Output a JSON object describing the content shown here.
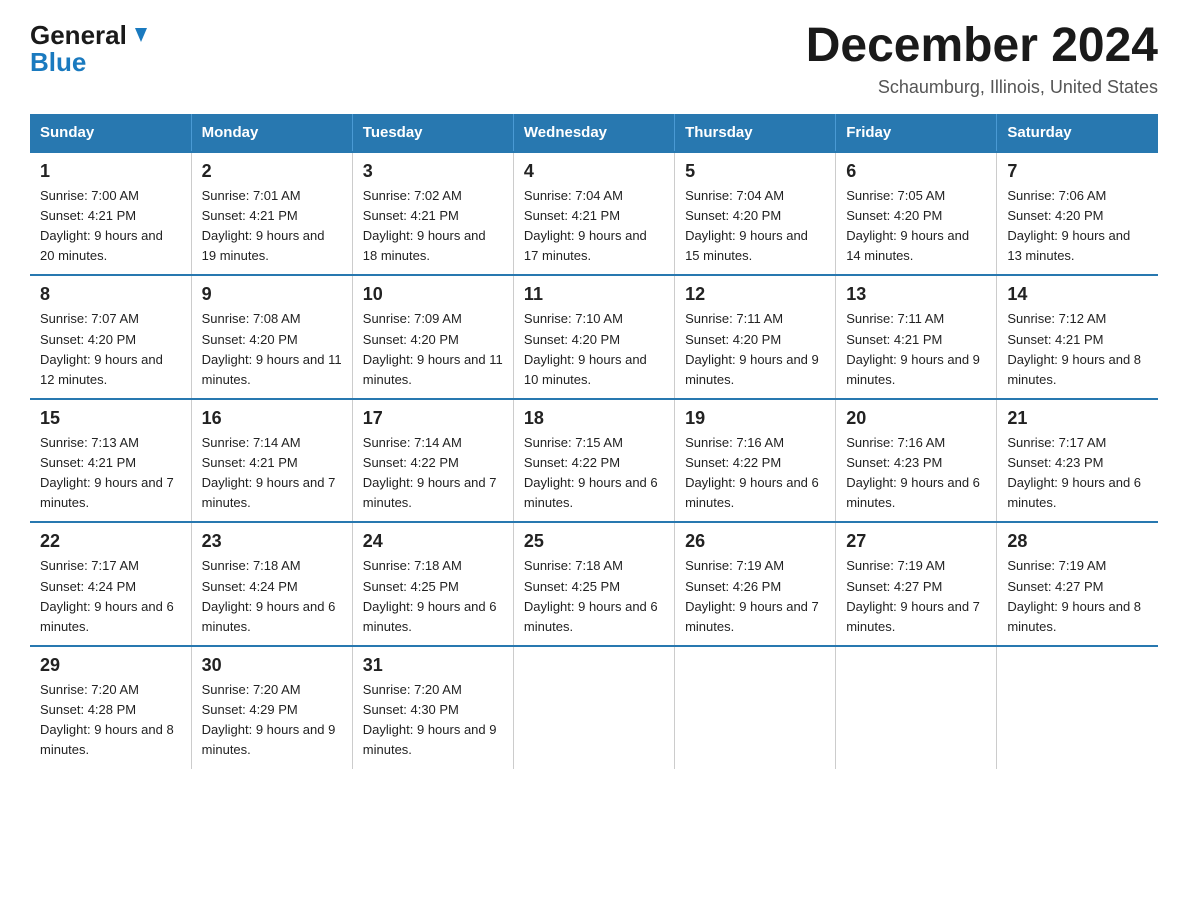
{
  "header": {
    "logo_general": "General",
    "logo_blue": "Blue",
    "title": "December 2024",
    "location": "Schaumburg, Illinois, United States"
  },
  "days_of_week": [
    "Sunday",
    "Monday",
    "Tuesday",
    "Wednesday",
    "Thursday",
    "Friday",
    "Saturday"
  ],
  "weeks": [
    [
      {
        "day": "1",
        "sunrise": "7:00 AM",
        "sunset": "4:21 PM",
        "daylight": "9 hours and 20 minutes."
      },
      {
        "day": "2",
        "sunrise": "7:01 AM",
        "sunset": "4:21 PM",
        "daylight": "9 hours and 19 minutes."
      },
      {
        "day": "3",
        "sunrise": "7:02 AM",
        "sunset": "4:21 PM",
        "daylight": "9 hours and 18 minutes."
      },
      {
        "day": "4",
        "sunrise": "7:04 AM",
        "sunset": "4:21 PM",
        "daylight": "9 hours and 17 minutes."
      },
      {
        "day": "5",
        "sunrise": "7:04 AM",
        "sunset": "4:20 PM",
        "daylight": "9 hours and 15 minutes."
      },
      {
        "day": "6",
        "sunrise": "7:05 AM",
        "sunset": "4:20 PM",
        "daylight": "9 hours and 14 minutes."
      },
      {
        "day": "7",
        "sunrise": "7:06 AM",
        "sunset": "4:20 PM",
        "daylight": "9 hours and 13 minutes."
      }
    ],
    [
      {
        "day": "8",
        "sunrise": "7:07 AM",
        "sunset": "4:20 PM",
        "daylight": "9 hours and 12 minutes."
      },
      {
        "day": "9",
        "sunrise": "7:08 AM",
        "sunset": "4:20 PM",
        "daylight": "9 hours and 11 minutes."
      },
      {
        "day": "10",
        "sunrise": "7:09 AM",
        "sunset": "4:20 PM",
        "daylight": "9 hours and 11 minutes."
      },
      {
        "day": "11",
        "sunrise": "7:10 AM",
        "sunset": "4:20 PM",
        "daylight": "9 hours and 10 minutes."
      },
      {
        "day": "12",
        "sunrise": "7:11 AM",
        "sunset": "4:20 PM",
        "daylight": "9 hours and 9 minutes."
      },
      {
        "day": "13",
        "sunrise": "7:11 AM",
        "sunset": "4:21 PM",
        "daylight": "9 hours and 9 minutes."
      },
      {
        "day": "14",
        "sunrise": "7:12 AM",
        "sunset": "4:21 PM",
        "daylight": "9 hours and 8 minutes."
      }
    ],
    [
      {
        "day": "15",
        "sunrise": "7:13 AM",
        "sunset": "4:21 PM",
        "daylight": "9 hours and 7 minutes."
      },
      {
        "day": "16",
        "sunrise": "7:14 AM",
        "sunset": "4:21 PM",
        "daylight": "9 hours and 7 minutes."
      },
      {
        "day": "17",
        "sunrise": "7:14 AM",
        "sunset": "4:22 PM",
        "daylight": "9 hours and 7 minutes."
      },
      {
        "day": "18",
        "sunrise": "7:15 AM",
        "sunset": "4:22 PM",
        "daylight": "9 hours and 6 minutes."
      },
      {
        "day": "19",
        "sunrise": "7:16 AM",
        "sunset": "4:22 PM",
        "daylight": "9 hours and 6 minutes."
      },
      {
        "day": "20",
        "sunrise": "7:16 AM",
        "sunset": "4:23 PM",
        "daylight": "9 hours and 6 minutes."
      },
      {
        "day": "21",
        "sunrise": "7:17 AM",
        "sunset": "4:23 PM",
        "daylight": "9 hours and 6 minutes."
      }
    ],
    [
      {
        "day": "22",
        "sunrise": "7:17 AM",
        "sunset": "4:24 PM",
        "daylight": "9 hours and 6 minutes."
      },
      {
        "day": "23",
        "sunrise": "7:18 AM",
        "sunset": "4:24 PM",
        "daylight": "9 hours and 6 minutes."
      },
      {
        "day": "24",
        "sunrise": "7:18 AM",
        "sunset": "4:25 PM",
        "daylight": "9 hours and 6 minutes."
      },
      {
        "day": "25",
        "sunrise": "7:18 AM",
        "sunset": "4:25 PM",
        "daylight": "9 hours and 6 minutes."
      },
      {
        "day": "26",
        "sunrise": "7:19 AM",
        "sunset": "4:26 PM",
        "daylight": "9 hours and 7 minutes."
      },
      {
        "day": "27",
        "sunrise": "7:19 AM",
        "sunset": "4:27 PM",
        "daylight": "9 hours and 7 minutes."
      },
      {
        "day": "28",
        "sunrise": "7:19 AM",
        "sunset": "4:27 PM",
        "daylight": "9 hours and 8 minutes."
      }
    ],
    [
      {
        "day": "29",
        "sunrise": "7:20 AM",
        "sunset": "4:28 PM",
        "daylight": "9 hours and 8 minutes."
      },
      {
        "day": "30",
        "sunrise": "7:20 AM",
        "sunset": "4:29 PM",
        "daylight": "9 hours and 9 minutes."
      },
      {
        "day": "31",
        "sunrise": "7:20 AM",
        "sunset": "4:30 PM",
        "daylight": "9 hours and 9 minutes."
      },
      null,
      null,
      null,
      null
    ]
  ]
}
